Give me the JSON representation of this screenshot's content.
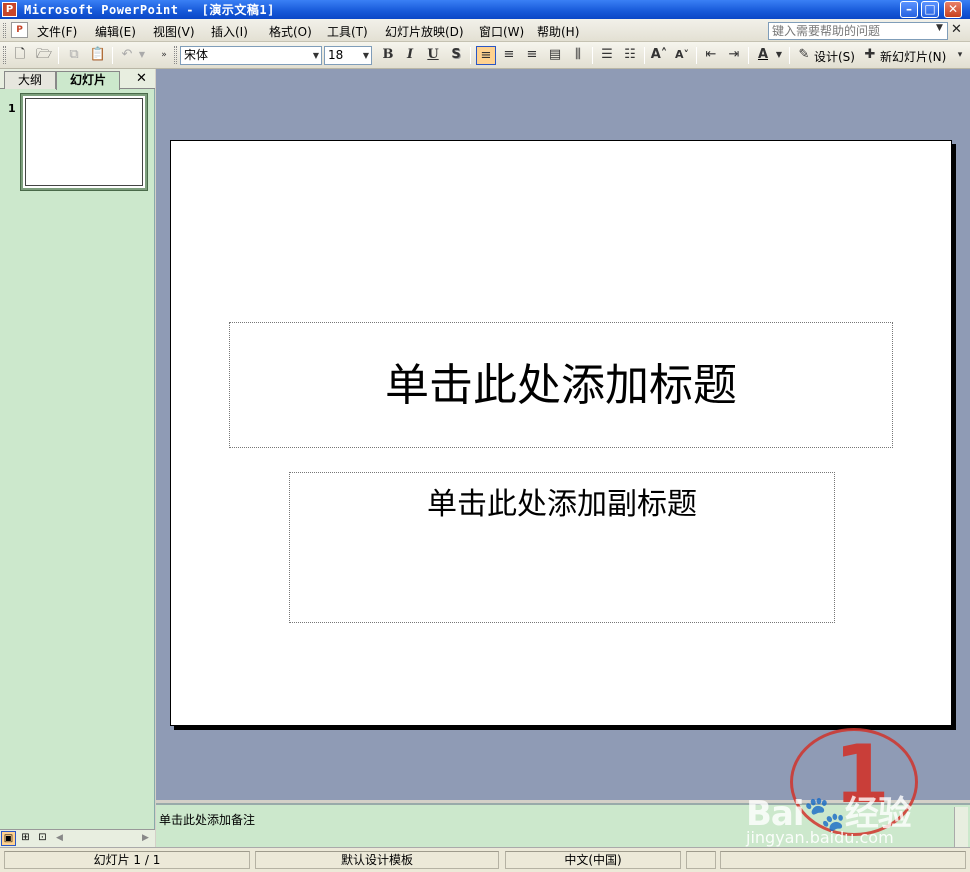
{
  "window": {
    "title": "Microsoft PowerPoint - [演示文稿1]",
    "app_icon": "P",
    "minimize": "–",
    "maximize": "□",
    "close": "✕"
  },
  "menu": {
    "items": [
      "文件(F)",
      "编辑(E)",
      "视图(V)",
      "插入(I)",
      "格式(O)",
      "工具(T)",
      "幻灯片放映(D)",
      "窗口(W)",
      "帮助(H)"
    ],
    "help_placeholder": "键入需要帮助的问题",
    "close_doc": "✕"
  },
  "toolbar": {
    "font_name": "宋体",
    "font_size": "18",
    "bold": "B",
    "italic": "I",
    "underline": "U",
    "shadow": "S",
    "design_label": "设计(S)",
    "new_slide_label": "新幻灯片(N)"
  },
  "left_pane": {
    "tab_outline": "大纲",
    "tab_slides": "幻灯片",
    "close": "✕",
    "slide_number": "1"
  },
  "slide": {
    "title_placeholder": "单击此处添加标题",
    "subtitle_placeholder": "单击此处添加副标题"
  },
  "notes": {
    "placeholder": "单击此处添加备注"
  },
  "status": {
    "slide_pos": "幻灯片 1 / 1",
    "template": "默认设计模板",
    "language": "中文(中国)"
  },
  "colors": {
    "titlebar": "#0a46c6",
    "pane_bg": "#cce8cc",
    "work_bg": "#8f9bb5",
    "watermark_red": "#d0342c"
  }
}
